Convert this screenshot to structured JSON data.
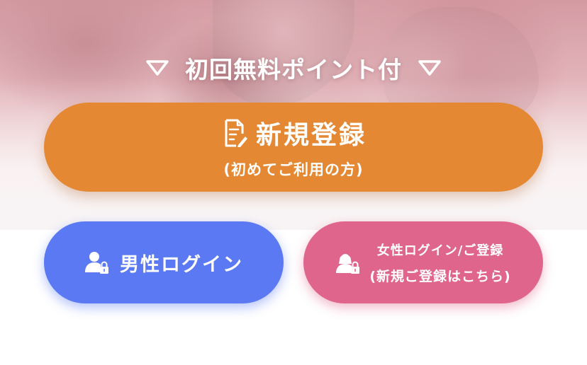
{
  "banner": {
    "text": "初回無料ポイント付",
    "left_icon": "triangle-down-icon",
    "right_icon": "triangle-down-icon"
  },
  "register": {
    "label": "新規登録",
    "sub_label": "(初めてご利用の方)",
    "icon": "document-edit-icon",
    "color": "#e48834"
  },
  "male_login": {
    "label": "男性ログイン",
    "icon": "user-lock-icon",
    "color": "#5b79f3"
  },
  "female_login": {
    "line1": "女性ログイン/ご登録",
    "line2": "(新規ご登録はこちら)",
    "icon": "female-user-lock-icon",
    "color": "#e0658c"
  }
}
